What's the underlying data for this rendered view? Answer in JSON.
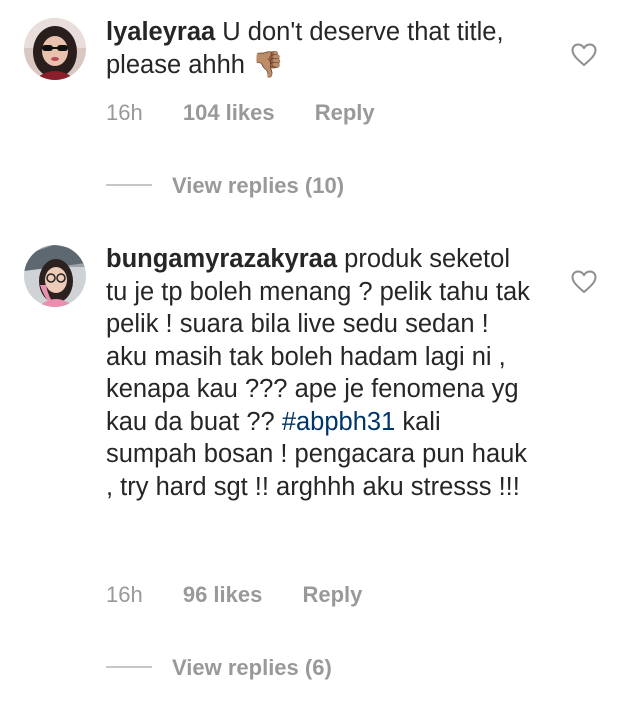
{
  "comments": [
    {
      "username": "lyaleyraa",
      "text": "U don't deserve that title,  please ahhh ",
      "emoji": "👎🏽",
      "time": "16h",
      "likes": "104 likes",
      "reply_label": "Reply",
      "view_replies": "View replies (10)",
      "heart_icon": "heart-outline-icon"
    },
    {
      "username": "bungamyrazakyraa",
      "text_before": "produk seketol tu je tp boleh menang ? pelik tahu tak pelik ! suara bila live sedu sedan ! aku masih tak boleh hadam lagi ni , kenapa kau ??? ape je fenomena yg kau da buat ?? ",
      "hashtag": "#abpbh31",
      "text_after": " kali sumpah bosan ! pengacara pun hauk , try hard sgt !! arghhh aku stresss !!!",
      "time": "16h",
      "likes": "96 likes",
      "reply_label": "Reply",
      "view_replies": "View replies (6)",
      "heart_icon": "heart-outline-icon"
    }
  ],
  "colors": {
    "text": "#262626",
    "meta": "#999999",
    "hashtag": "#003569",
    "divider": "#c7c7c7"
  }
}
